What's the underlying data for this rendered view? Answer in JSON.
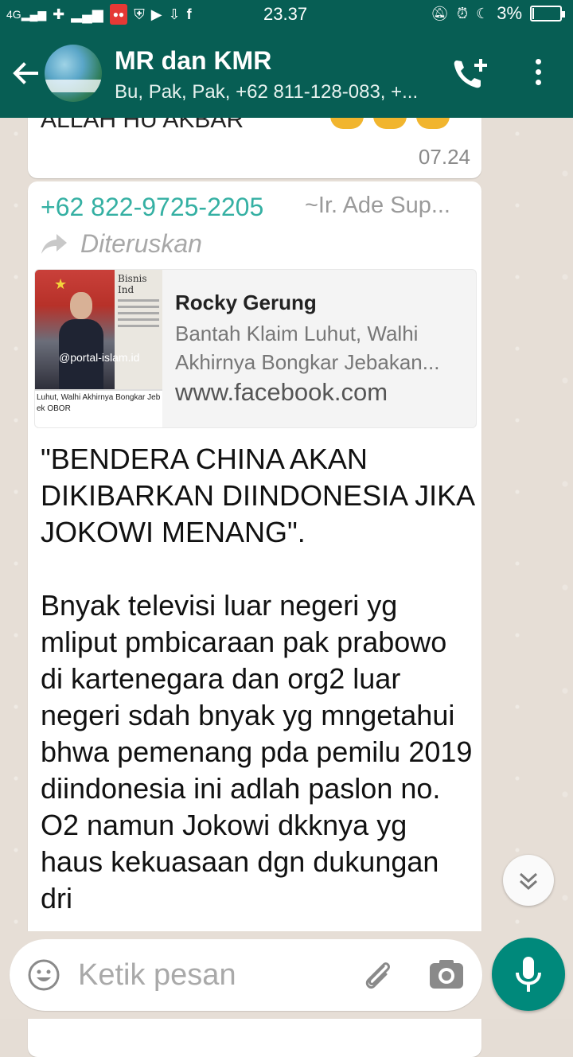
{
  "status_bar": {
    "time": "23.37",
    "battery": "3%",
    "battery_level": 0.03,
    "network": "4G"
  },
  "header": {
    "title": "MR dan KMR",
    "subtitle": "Bu, Pak, Pak, +62 811-128-083, +..."
  },
  "messages": {
    "previous": {
      "text": "ALLAH HU AKBAR",
      "time": "07.24"
    },
    "current": {
      "sender_phone": "+62 822-9725-2205",
      "sender_name": "~Ir. Ade Sup...",
      "forwarded_label": "Diteruskan",
      "link_preview": {
        "title": "Rocky Gerung",
        "description_line1": "Bantah Klaim Luhut, Walhi",
        "description_line2": "Akhirnya Bongkar Jebakan...",
        "domain": "www.facebook.com",
        "thumbnail_watermark": "@portal-islam.id",
        "thumbnail_paper": "Bisnis Ind",
        "thumbnail_caption": "Luhut, Walhi Akhirnya Bongkar Jeb\nek OBOR"
      },
      "body": "\"BENDERA CHINA AKAN DIKIBARKAN DIINDONESIA JIKA JOKOWI MENANG\".\n\nBnyak televisi luar negeri yg mliput pmbicaraan pak prabowo di kartenegara dan org2 luar negeri sdah bnyak yg mngetahui bhwa pemenang pda pemilu 2019 diindonesia ini adlah paslon no. O2 namun Jokowi dkknya yg haus kekuasaan dgn dukungan dri"
    }
  },
  "composer": {
    "placeholder": "Ketik pesan"
  },
  "colors": {
    "header": "#075e54",
    "accent": "#00897b",
    "sender": "#35b0a3"
  },
  "icons": [
    "back-arrow-icon",
    "add-call-icon",
    "more-vert-icon",
    "forward-icon",
    "scroll-down-icon",
    "emoji-icon",
    "attach-icon",
    "camera-icon",
    "mic-icon"
  ]
}
